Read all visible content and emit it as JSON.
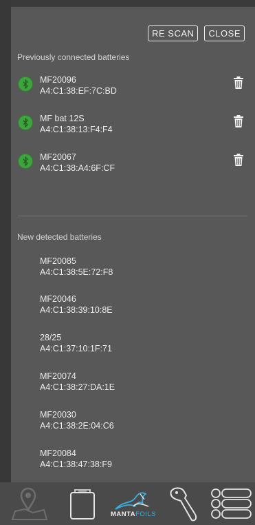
{
  "buttons": {
    "rescan": "RE SCAN",
    "close": "CLOSE"
  },
  "previous": {
    "label": "Previously connected batteries",
    "items": [
      {
        "name": "MF20096",
        "mac": "A4:C1:38:EF:7C:BD"
      },
      {
        "name": "MF bat 12S",
        "mac": "A4:C1:38:13:F4:F4"
      },
      {
        "name": "MF20067",
        "mac": "A4:C1:38:A4:6F:CF"
      }
    ]
  },
  "detected": {
    "label": "New detected batteries",
    "items": [
      {
        "name": "MF20085",
        "mac": "A4:C1:38:5E:72:F8"
      },
      {
        "name": "MF20046",
        "mac": "A4:C1:38:39:10:8E"
      },
      {
        "name": "28/25",
        "mac": "A4:C1:37:10:1F:71"
      },
      {
        "name": "MF20074",
        "mac": "A4:C1:38:27:DA:1E"
      },
      {
        "name": "MF20030",
        "mac": "A4:C1:38:2E:04:C6"
      },
      {
        "name": "MF20084",
        "mac": "A4:C1:38:47:38:F9"
      }
    ]
  },
  "nav": {
    "logo_part1": "MANTA",
    "logo_part2": "FOILS",
    "icons": [
      "map-pin-icon",
      "battery-icon",
      "mantafoils-logo",
      "hydrofoil-icon",
      "menu-list-icon"
    ]
  },
  "colors": {
    "bluetooth_green": "#3fa43f",
    "panel": "#585858",
    "accent_blue": "#3ab0e0"
  }
}
